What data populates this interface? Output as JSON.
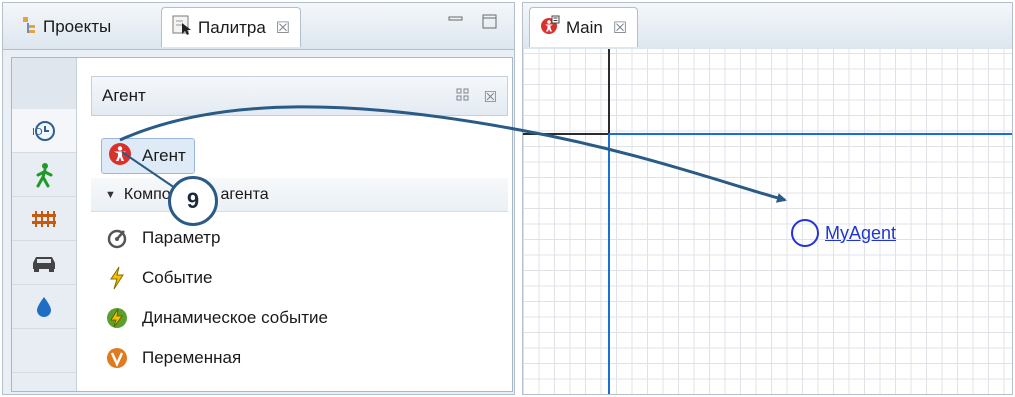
{
  "left_view": {
    "tabs": [
      {
        "label": "Проекты",
        "icon": "projects-icon"
      },
      {
        "label": "Палитра",
        "icon": "palette-icon",
        "close": "☒"
      }
    ],
    "minimize_icon": "minimize-icon",
    "maximize_icon": "maximize-icon"
  },
  "palette": {
    "side_icons": [
      "agent-time-icon",
      "pedestrian-icon",
      "rail-icon",
      "car-icon",
      "fluid-drop-icon"
    ],
    "section_title": "Агент",
    "agent_item_label": "Агент",
    "group_label": "Компоненты агента",
    "items": [
      {
        "label": "Параметр",
        "icon": "parameter-icon"
      },
      {
        "label": "Событие",
        "icon": "event-icon"
      },
      {
        "label": "Динамическое событие",
        "icon": "dynamic-event-icon"
      },
      {
        "label": "Переменная",
        "icon": "variable-icon"
      }
    ]
  },
  "editor": {
    "tab_label": "Main",
    "tab_close": "☒",
    "agent_label": "MyAgent"
  },
  "callout": {
    "number": "9"
  },
  "colors": {
    "axis_blue": "#1a6fd6",
    "agent_blue": "#2233dd",
    "callout_border": "#2a5a86"
  }
}
